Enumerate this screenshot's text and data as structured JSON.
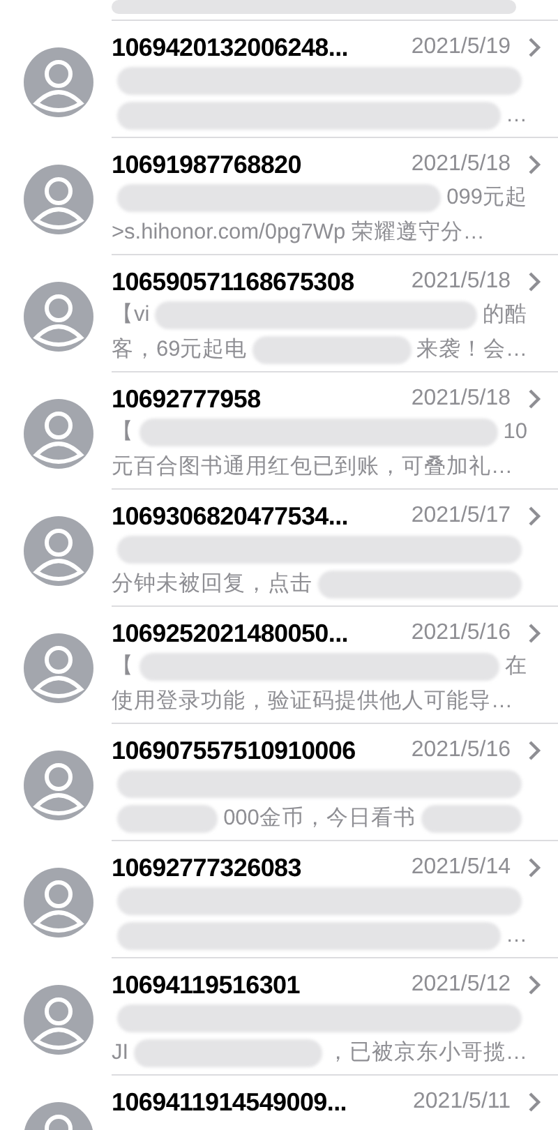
{
  "messages": [
    {
      "sender": "1069420132006248...",
      "date": "2021/5/19",
      "preview": [
        [
          {
            "kind": "blur"
          }
        ],
        [
          {
            "kind": "blur"
          },
          {
            "kind": "text",
            "text": "…"
          }
        ]
      ]
    },
    {
      "sender": "10691987768820",
      "date": "2021/5/18",
      "preview": [
        [
          {
            "kind": "blur"
          },
          {
            "kind": "text",
            "text": "099元起"
          }
        ],
        [
          {
            "kind": "text",
            "text": ">s.hihonor.com/0pg7Wp 荣耀遵守分…"
          }
        ]
      ]
    },
    {
      "sender": "106590571168675308",
      "date": "2021/5/18",
      "preview": [
        [
          {
            "kind": "text",
            "text": "【vi"
          },
          {
            "kind": "blur"
          },
          {
            "kind": "text",
            "text": "的酷"
          }
        ],
        [
          {
            "kind": "text",
            "text": "客，69元起电"
          },
          {
            "kind": "blur"
          },
          {
            "kind": "text",
            "text": "来袭！会…"
          }
        ]
      ]
    },
    {
      "sender": "10692777958",
      "date": "2021/5/18",
      "preview": [
        [
          {
            "kind": "text",
            "text": "【"
          },
          {
            "kind": "blur"
          },
          {
            "kind": "text",
            "text": "10"
          }
        ],
        [
          {
            "kind": "text",
            "text": "元百合图书通用红包已到账，可叠加礼…"
          }
        ]
      ]
    },
    {
      "sender": "1069306820477534...",
      "date": "2021/5/17",
      "preview": [
        [
          {
            "kind": "blur"
          }
        ],
        [
          {
            "kind": "text",
            "text": "分钟未被回复，点击"
          },
          {
            "kind": "blur"
          }
        ]
      ]
    },
    {
      "sender": "1069252021480050...",
      "date": "2021/5/16",
      "preview": [
        [
          {
            "kind": "text",
            "text": "【"
          },
          {
            "kind": "blur"
          },
          {
            "kind": "text",
            "text": "在"
          }
        ],
        [
          {
            "kind": "text",
            "text": "使用登录功能，验证码提供他人可能导…"
          }
        ]
      ]
    },
    {
      "sender": "106907557510910006",
      "date": "2021/5/16",
      "preview": [
        [
          {
            "kind": "blur"
          }
        ],
        [
          {
            "kind": "blur"
          },
          {
            "kind": "text",
            "text": "000金币，今日看书"
          },
          {
            "kind": "blur"
          }
        ]
      ]
    },
    {
      "sender": "10692777326083",
      "date": "2021/5/14",
      "preview": [
        [
          {
            "kind": "blur"
          }
        ],
        [
          {
            "kind": "blur"
          },
          {
            "kind": "text",
            "text": "…"
          }
        ]
      ]
    },
    {
      "sender": "10694119516301",
      "date": "2021/5/12",
      "preview": [
        [
          {
            "kind": "blur"
          }
        ],
        [
          {
            "kind": "text",
            "text": "JI"
          },
          {
            "kind": "blur"
          },
          {
            "kind": "text",
            "text": "，已被京东小哥揽…"
          }
        ]
      ]
    },
    {
      "sender": "1069411914549009...",
      "date": "2021/5/11"
    }
  ]
}
